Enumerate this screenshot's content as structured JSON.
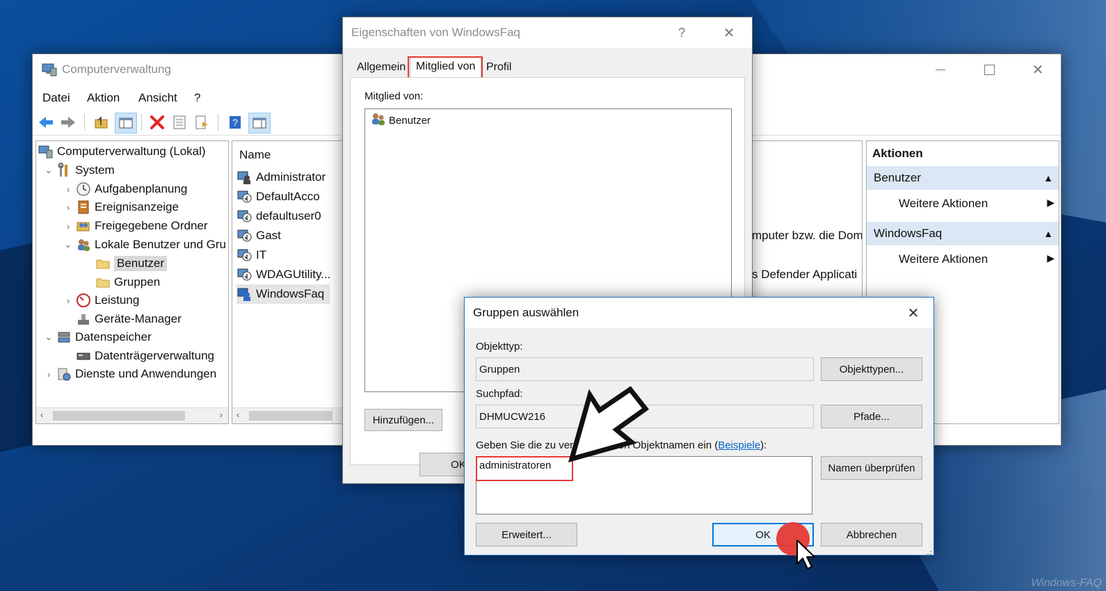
{
  "computer_management": {
    "title": "Computerverwaltung",
    "menu": [
      "Datei",
      "Aktion",
      "Ansicht",
      "?"
    ],
    "tree": [
      {
        "label": "Computerverwaltung (Lokal)",
        "icon": "computer-management-icon"
      },
      {
        "label": "System",
        "icon": "tools-icon"
      },
      {
        "label": "Aufgabenplanung",
        "icon": "clock-icon"
      },
      {
        "label": "Ereignisanzeige",
        "icon": "event-viewer-icon"
      },
      {
        "label": "Freigegebene Ordner",
        "icon": "shared-folder-icon"
      },
      {
        "label": "Lokale Benutzer und Gru",
        "icon": "users-icon"
      },
      {
        "label": "Benutzer",
        "icon": "folder-icon"
      },
      {
        "label": "Gruppen",
        "icon": "folder-icon"
      },
      {
        "label": "Leistung",
        "icon": "performance-icon"
      },
      {
        "label": "Geräte-Manager",
        "icon": "device-manager-icon"
      },
      {
        "label": "Datenspeicher",
        "icon": "storage-icon"
      },
      {
        "label": "Datenträgerverwaltung",
        "icon": "disk-icon"
      },
      {
        "label": "Dienste und Anwendungen",
        "icon": "services-icon"
      }
    ],
    "list_header": "Name",
    "users": [
      "Administrator",
      "DefaultAcco",
      "defaultuser0",
      "Gast",
      "IT",
      "WDAGUtility...",
      "WindowsFaq"
    ],
    "description_fragments": [
      "mputer bzw. die Dom",
      "s Defender Applicati"
    ],
    "actions": {
      "header": "Aktionen",
      "sections": [
        {
          "title": "Benutzer",
          "item": "Weitere Aktionen"
        },
        {
          "title": "WindowsFaq",
          "item": "Weitere Aktionen"
        }
      ]
    }
  },
  "properties": {
    "title": "Eigenschaften von WindowsFaq",
    "help": "?",
    "tabs": [
      "Allgemein",
      "Mitglied von",
      "Profil"
    ],
    "member_of_label": "Mitglied von:",
    "members": [
      "Benutzer"
    ],
    "add_button": "Hinzufügen...",
    "ok_button": "OK"
  },
  "select_groups": {
    "title": "Gruppen auswählen",
    "object_type_label": "Objekttyp:",
    "object_type_value": "Gruppen",
    "object_types_button": "Objekttypen...",
    "search_path_label": "Suchpfad:",
    "search_path_value": "DHMUCW216",
    "paths_button": "Pfade...",
    "enter_names_label": "Geben Sie die zu ver",
    "enter_names_label_end": "nden Objektnamen ein (",
    "examples_link": "Beispiele",
    "enter_names_label_close": "):",
    "names_value": "administratoren",
    "check_names_button": "Namen überprüfen",
    "advanced_button": "Erweitert...",
    "ok_button": "OK",
    "cancel_button": "Abbrechen"
  },
  "watermark": "Windows-FAQ",
  "colors": {
    "accent": "#0078d7",
    "highlight": "#e53935",
    "desktop": "#0a3d7a"
  }
}
